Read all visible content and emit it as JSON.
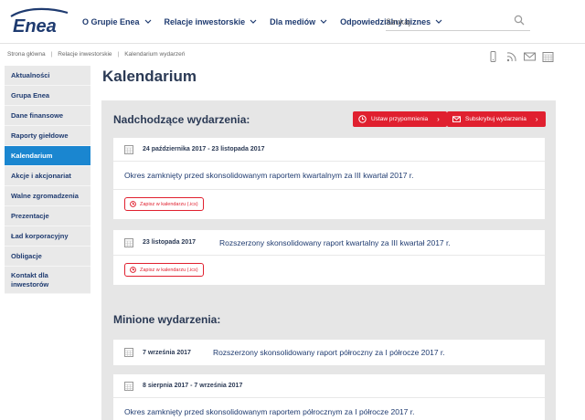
{
  "brand": {
    "logo_text": "Enea",
    "color": "#1f3b70",
    "accent": "#e0202f",
    "active": "#1a86d0"
  },
  "nav": {
    "items": [
      {
        "label": "O Grupie Enea"
      },
      {
        "label": "Relacje inwestorskie"
      },
      {
        "label": "Dla mediów"
      },
      {
        "label": "Odpowiedzialny biznes"
      }
    ]
  },
  "search": {
    "placeholder": "Szukaj",
    "icon": "search-icon"
  },
  "breadcrumb": {
    "items": [
      "Strona główna",
      "Relacje inwestorskie",
      "Kalendarium wydarzeń"
    ]
  },
  "tools": [
    "mobile-icon",
    "rss-icon",
    "mail-icon",
    "calendar-icon"
  ],
  "sidebar": {
    "items": [
      {
        "label": "Aktualności"
      },
      {
        "label": "Grupa Enea"
      },
      {
        "label": "Dane finansowe"
      },
      {
        "label": "Raporty giełdowe"
      },
      {
        "label": "Kalendarium",
        "active": true
      },
      {
        "label": "Akcje i akcjonariat"
      },
      {
        "label": "Walne zgromadzenia"
      },
      {
        "label": "Prezentacje"
      },
      {
        "label": "Ład korporacyjny"
      },
      {
        "label": "Obligacje"
      },
      {
        "label": "Kontakt dla inwestorów"
      }
    ]
  },
  "page": {
    "title": "Kalendarium"
  },
  "upcoming": {
    "title": "Nadchodzące wydarzenia:",
    "reminder_button": "Ustaw przypomnienia",
    "subscribe_button": "Subskrybuj wydarzenia",
    "events": [
      {
        "date": "24 października 2017 - 23 listopada 2017",
        "title": "Okres zamknięty przed skonsolidowanym raportem kwartalnym za III kwartał 2017 r.",
        "calendar_link": "Zapisz w kalendarzu (.ics)"
      },
      {
        "date": "23 listopada 2017",
        "title": "Rozszerzony skonsolidowany raport kwartalny za III kwartał 2017 r.",
        "calendar_link": "Zapisz w kalendarzu (.ics)"
      }
    ]
  },
  "past": {
    "title": "Minione wydarzenia:",
    "events": [
      {
        "date": "7 września 2017",
        "title": "Rozszerzony skonsolidowany raport półroczny za I półrocze 2017 r."
      },
      {
        "date": "8 sierpnia 2017 - 7 września 2017",
        "title": "Okres zamknięty przed skonsolidowanym raportem półrocznym za I półrocze 2017 r."
      }
    ]
  }
}
